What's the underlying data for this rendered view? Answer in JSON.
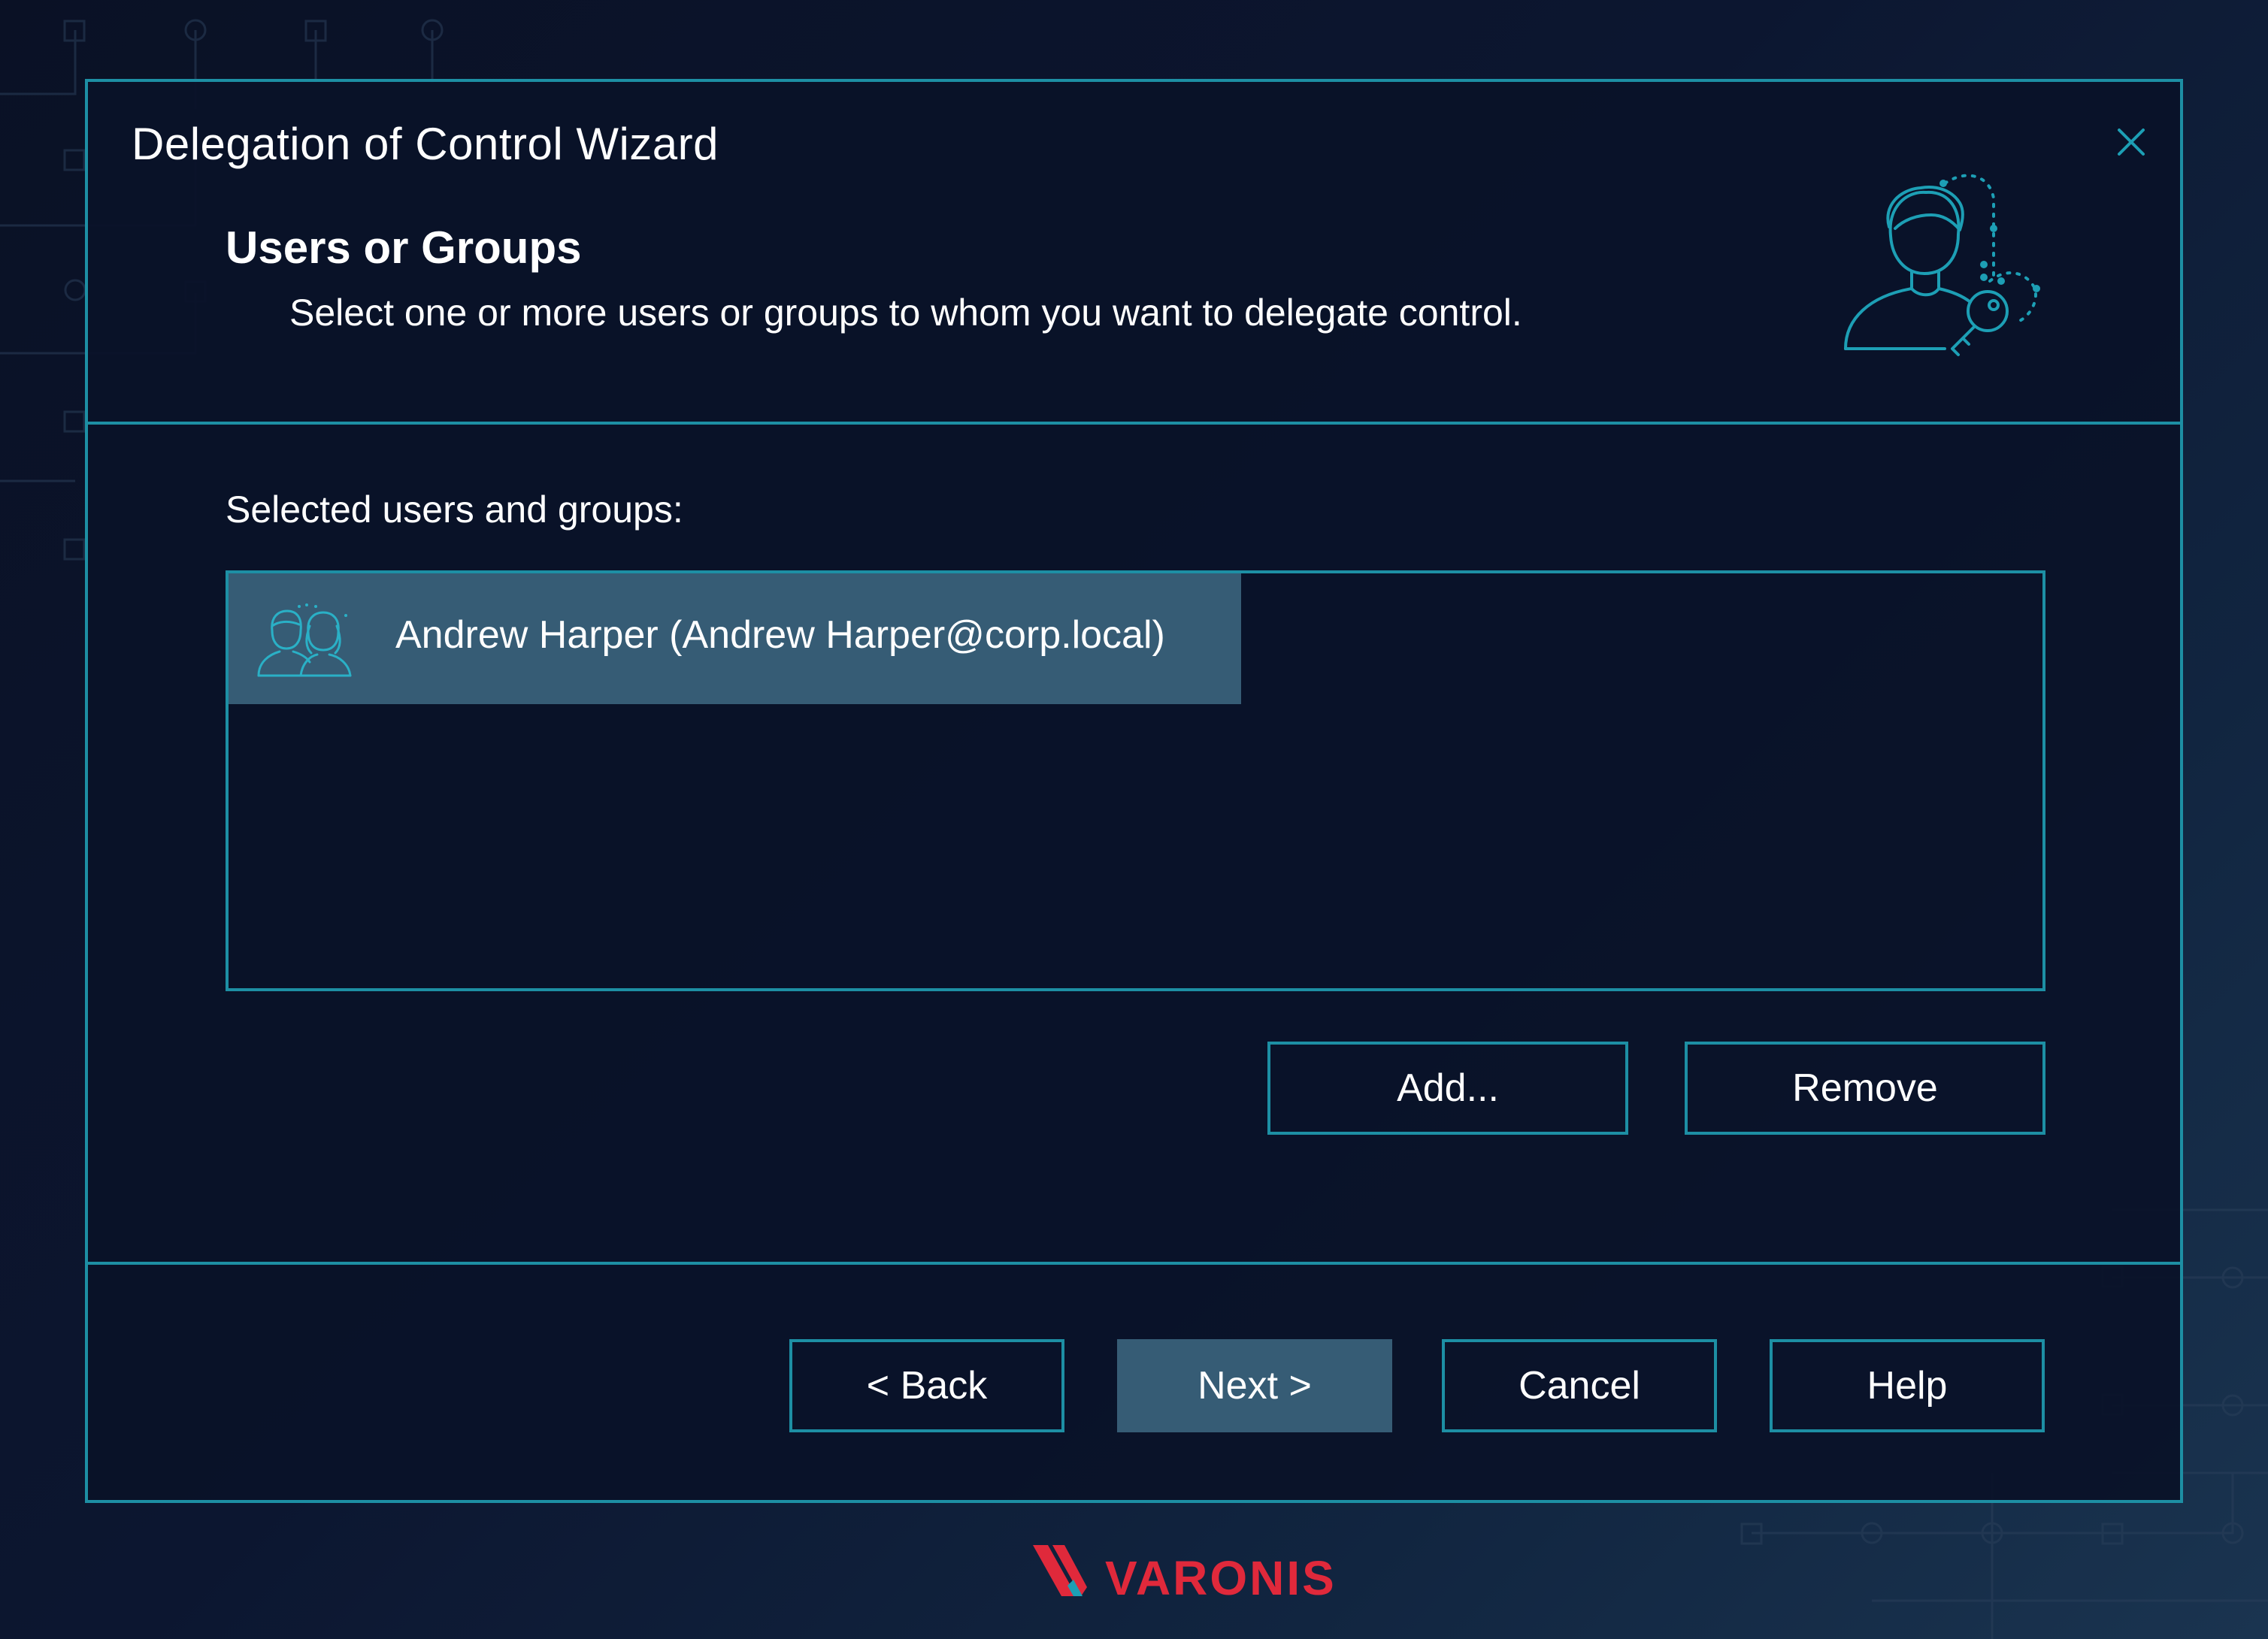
{
  "window": {
    "title": "Delegation of Control Wizard",
    "close_icon": "close-icon"
  },
  "header": {
    "section_title": "Users or Groups",
    "description": "Select one or more users or groups to whom you want to delegate control.",
    "icon": "user-key-icon"
  },
  "selection": {
    "label": "Selected users and groups:",
    "items": [
      {
        "label": "Andrew Harper (Andrew Harper@corp.local)",
        "icon": "group-icon",
        "selected": true
      }
    ]
  },
  "actions": {
    "add_label": "Add...",
    "remove_label": "Remove"
  },
  "footer": {
    "back_label": "< Back",
    "next_label": "Next >",
    "cancel_label": "Cancel",
    "help_label": "Help"
  },
  "brand": {
    "name": "VARONIS",
    "color": "#e0293b"
  },
  "colors": {
    "accent": "#1d8fa4",
    "selected_bg": "#365c75",
    "background": "#0c1428"
  }
}
